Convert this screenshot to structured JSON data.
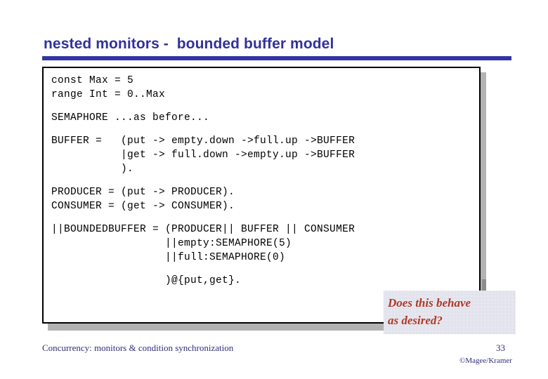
{
  "slide": {
    "title": "nested monitors -  bounded buffer model",
    "page_number": "33",
    "footer_note": "Concurrency: monitors & condition synchronization",
    "copyright": "©Magee/Kramer",
    "colors": {
      "title_blue": "#31319c",
      "rule_blue": "#3333a8",
      "annotation_red": "#b03a26",
      "footer_navy": "#2f2f7a",
      "code_border": "#000000",
      "shadow_gray": "#b3b3b3"
    }
  },
  "code": {
    "lines": [
      "const Max = 5",
      "range Int = 0..Max",
      "",
      "SEMAPHORE ...as before...",
      "",
      "BUFFER =   (put -> empty.down ->full.up ->BUFFER",
      "           |get -> full.down ->empty.up ->BUFFER",
      "           ).",
      "",
      "PRODUCER = (put -> PRODUCER).",
      "CONSUMER = (get -> CONSUMER).",
      "",
      "||BOUNDEDBUFFER = (PRODUCER|| BUFFER || CONSUMER",
      "                  ||empty:SEMAPHORE(5)",
      "                  ||full:SEMAPHORE(0)",
      "",
      "                  )@{put,get}."
    ]
  },
  "annotation": {
    "line1": "Does this behave",
    "line2": "as desired?"
  }
}
